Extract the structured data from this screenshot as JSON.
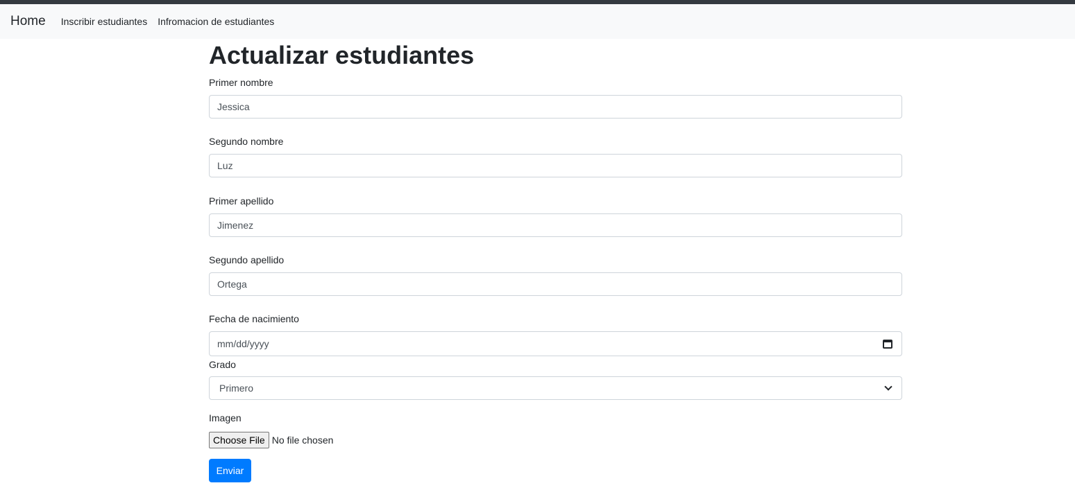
{
  "nav": {
    "brand": "Home",
    "links": [
      "Inscribir estudiantes",
      "Infromacion de estudiantes"
    ]
  },
  "page": {
    "title": "Actualizar estudiantes"
  },
  "form": {
    "primer_nombre": {
      "label": "Primer nombre",
      "value": "Jessica"
    },
    "segundo_nombre": {
      "label": "Segundo nombre",
      "value": "Luz"
    },
    "primer_apellido": {
      "label": "Primer apellido",
      "value": "Jimenez"
    },
    "segundo_apellido": {
      "label": "Segundo apellido",
      "value": "Ortega"
    },
    "fecha_nacimiento": {
      "label": "Fecha de nacimiento",
      "placeholder": "mm/dd/yyyy",
      "icon": "calendar-icon"
    },
    "grado": {
      "label": "Grado",
      "selected": "Primero",
      "icon": "chevron-down-icon"
    },
    "imagen": {
      "label": "Imagen",
      "button_label": "Choose File",
      "status": "No file chosen"
    },
    "submit_label": "Enviar"
  },
  "colors": {
    "accent": "#007bff",
    "navbar_bg": "#f8f9fa",
    "topbar": "#343a40"
  }
}
